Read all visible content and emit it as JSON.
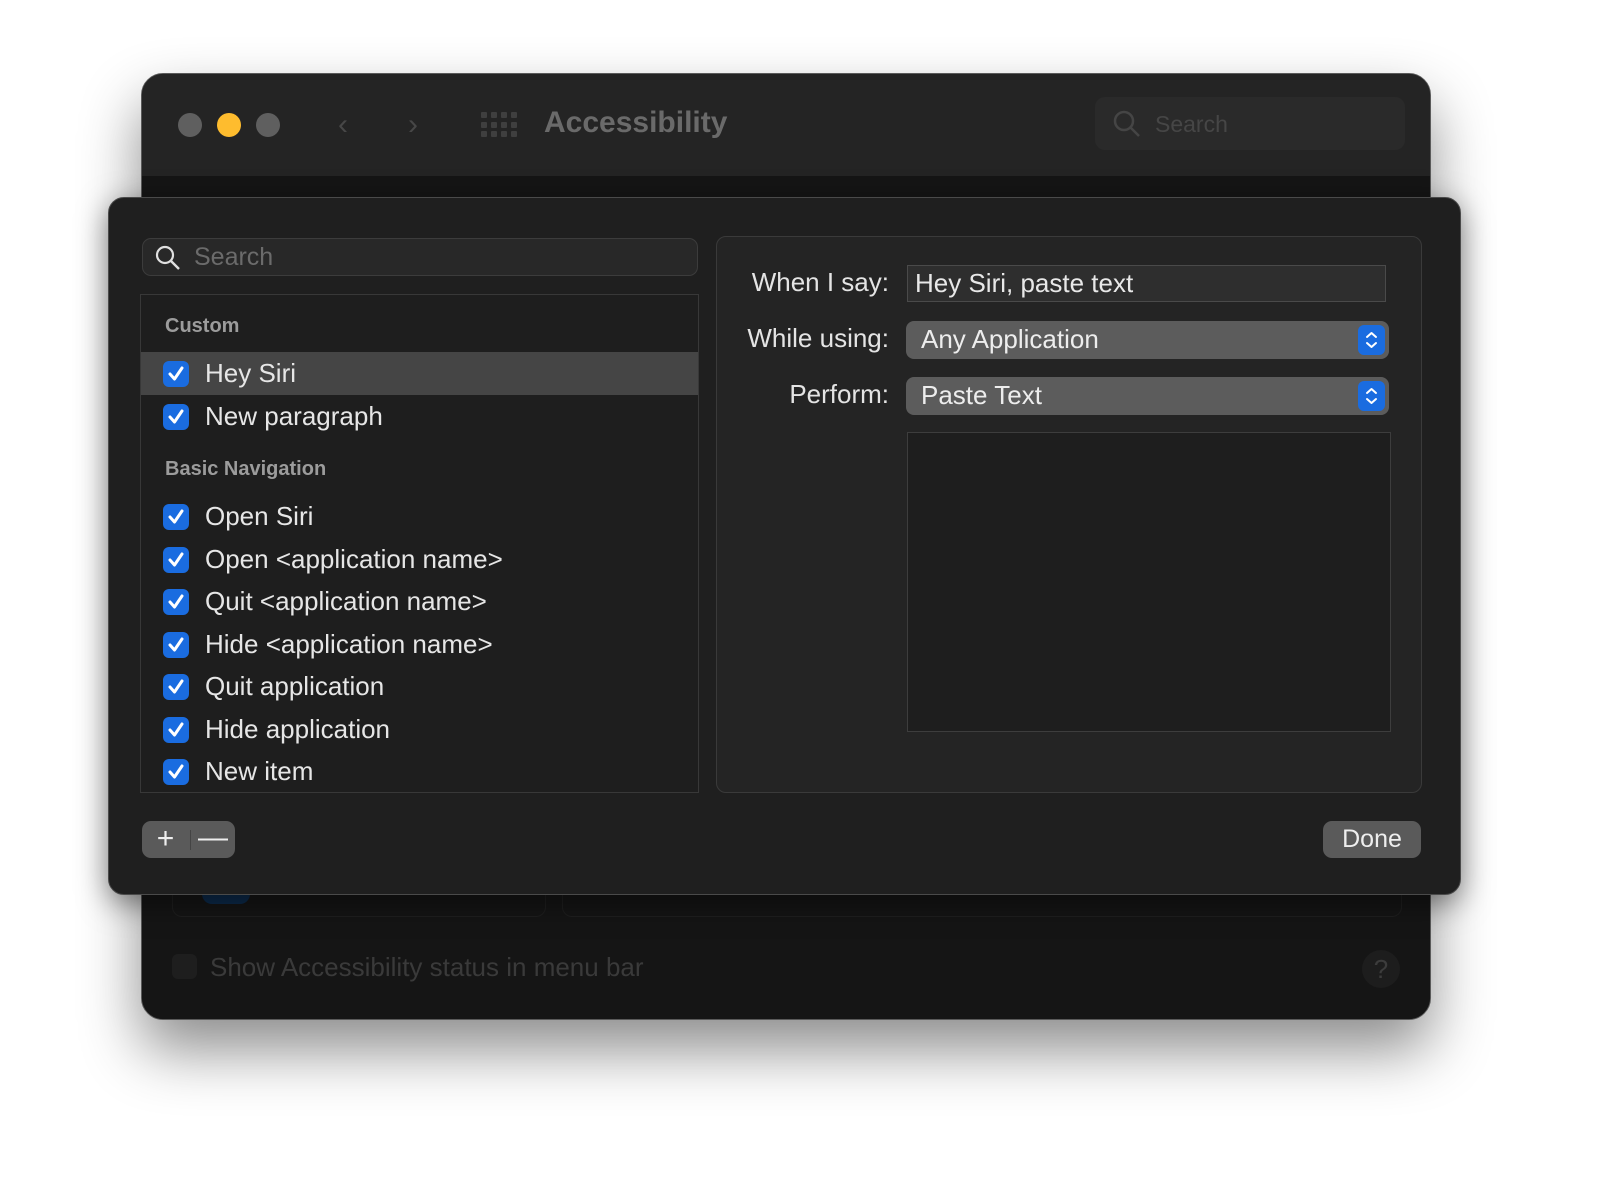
{
  "window": {
    "title": "Accessibility",
    "search_placeholder": "Search",
    "nav_back": "‹",
    "nav_forward": "›",
    "background": {
      "checkbox_label": "Show Accessibility status in menu bar",
      "help_label": "?"
    }
  },
  "sheet": {
    "search_placeholder": "Search",
    "sections": [
      {
        "title": "Custom",
        "items": [
          {
            "label": "Hey Siri",
            "checked": true,
            "selected": true
          },
          {
            "label": "New paragraph",
            "checked": true,
            "selected": false
          }
        ]
      },
      {
        "title": "Basic Navigation",
        "items": [
          {
            "label": "Open Siri",
            "checked": true
          },
          {
            "label": "Open <application name>",
            "checked": true
          },
          {
            "label": "Quit <application name>",
            "checked": true
          },
          {
            "label": "Hide <application name>",
            "checked": true
          },
          {
            "label": "Quit application",
            "checked": true
          },
          {
            "label": "Hide application",
            "checked": true
          },
          {
            "label": "New item",
            "checked": true
          }
        ]
      }
    ],
    "form": {
      "when_label": "When I say:",
      "when_value": "Hey Siri, paste text",
      "while_label": "While using:",
      "while_value": "Any Application",
      "perform_label": "Perform:",
      "perform_value": "Paste Text",
      "text_content": ""
    },
    "add_label": "+",
    "remove_label": "—",
    "done_label": "Done"
  },
  "colors": {
    "accent": "#1a6ce0",
    "minimize": "#febc2e"
  }
}
